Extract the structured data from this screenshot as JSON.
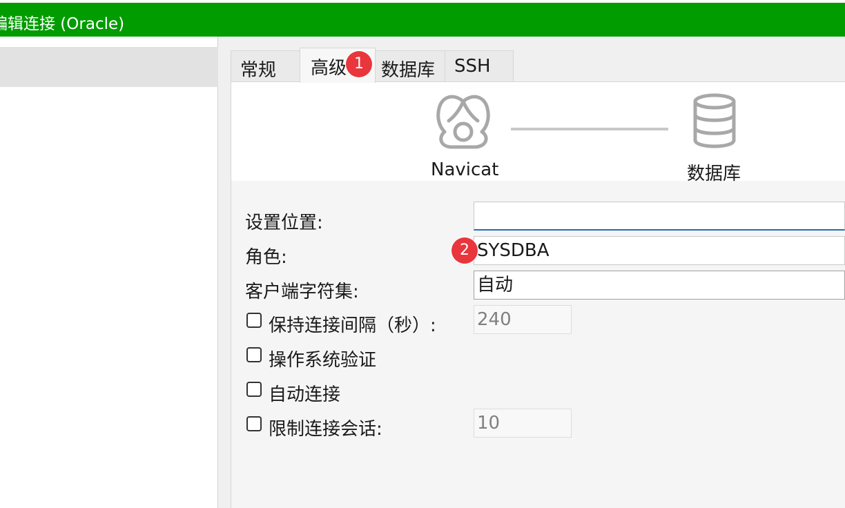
{
  "window": {
    "title": "编辑连接 (Oracle)",
    "title_visible": "连接 (Oracle)",
    "bar_color": "#009c00"
  },
  "tabs": [
    {
      "label": "常规",
      "active": false
    },
    {
      "label": "高级",
      "active": true
    },
    {
      "label": "数据库",
      "active": false
    },
    {
      "label": "SSH",
      "active": false
    }
  ],
  "hero": {
    "left_label": "Navicat",
    "right_label": "数据库",
    "left_icon": "navicat-logo-icon",
    "right_icon": "database-icon"
  },
  "form": {
    "settings_location": {
      "label": "设置位置:",
      "value": ""
    },
    "role": {
      "label": "角色:",
      "value": "SYSDBA"
    },
    "charset": {
      "label": "客户端字符集:",
      "value": "自动"
    },
    "keepalive": {
      "label": "保持连接间隔（秒）:",
      "checked": false,
      "value": "240"
    },
    "os_auth": {
      "label": "操作系统验证",
      "checked": false
    },
    "auto_connect": {
      "label": "自动连接",
      "checked": false
    },
    "limit_sessions": {
      "label": "限制连接会话:",
      "checked": false,
      "value": "10"
    }
  },
  "annotations": {
    "badge1": "1",
    "badge2": "2",
    "badge_color": "#e8363c"
  }
}
